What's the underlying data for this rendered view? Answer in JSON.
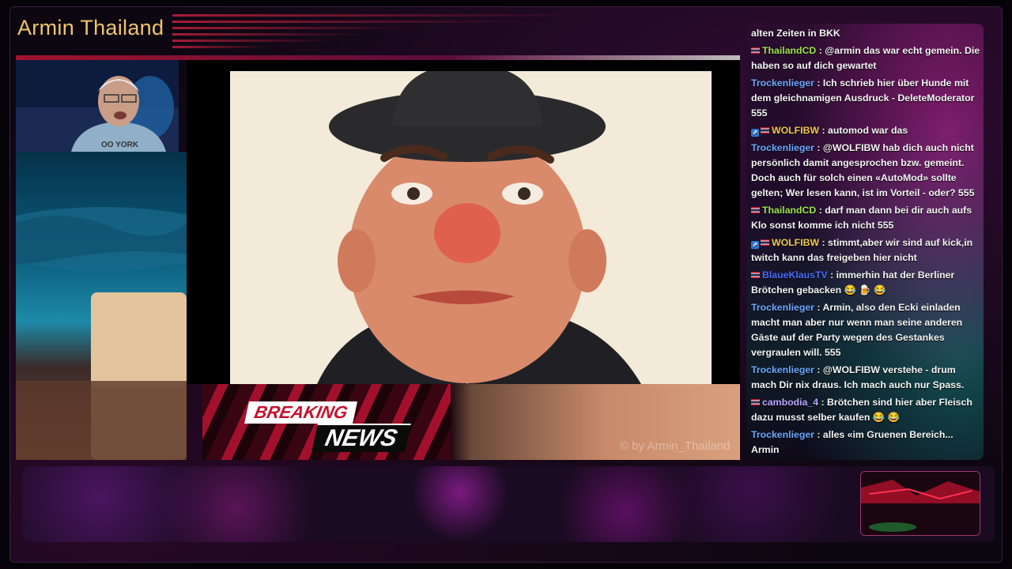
{
  "stream": {
    "channel_title": "Armin Thailand",
    "breaking_label": "BREAKING",
    "news_label": "NEWS",
    "watermark": "© by Armin_Thailand"
  },
  "colors": {
    "title": "#f2c46a",
    "breaking_red": "#c5102d",
    "user_green": "#9be34a",
    "user_blue": "#6aa8ff",
    "user_yellow": "#f0c84a",
    "user_lightblue": "#7fd0ff",
    "user_purple": "#b9a6ff",
    "user_deepblue": "#4a6aff"
  },
  "chat": {
    "messages": [
      {
        "user": "",
        "text": "alten Zeiten in BKK",
        "flag": false,
        "badge": false,
        "color": "#f4f4f4"
      },
      {
        "user": "ThailandCD",
        "text": " : @armin das war echt gemein. Die haben so auf dich gewartet",
        "flag": true,
        "badge": false,
        "color": "#9be34a"
      },
      {
        "user": "Trockenlieger",
        "text": " : Ich schrieb hier über Hunde mit dem gleichnamigen Ausdruck - DeleteModerator 555",
        "flag": false,
        "badge": false,
        "color": "#6aa8ff"
      },
      {
        "user": "WOLFIBW",
        "text": " : automod war das",
        "flag": true,
        "badge": true,
        "color": "#f0c84a"
      },
      {
        "user": "Trockenlieger",
        "text": " : @WOLFIBW hab dich auch nicht persönlich damit angesprochen bzw. gemeint. Doch auch für solch einen «AutoMod» sollte gelten; Wer lesen kann, ist im Vorteil - oder? 555",
        "flag": false,
        "badge": false,
        "color": "#6aa8ff"
      },
      {
        "user": "ThailandCD",
        "text": " : darf man dann bei dir auch aufs Klo sonst komme ich nicht 555",
        "flag": true,
        "badge": false,
        "color": "#9be34a"
      },
      {
        "user": "WOLFIBW",
        "text": " : stimmt,aber wir sind auf kick,in twitch kann das freigeben hier nicht",
        "flag": true,
        "badge": true,
        "color": "#f0c84a"
      },
      {
        "user": "BlaueKlausTV",
        "text": " : immerhin hat der Berliner Brötchen gebacken 😂 🍺 😂",
        "flag": true,
        "badge": false,
        "color": "#4a6aff"
      },
      {
        "user": "Trockenlieger",
        "text": " : Armin, also den Ecki einladen macht man aber nur wenn man seine anderen Gäste auf der Party wegen des Gestankes vergraulen will. 555",
        "flag": false,
        "badge": false,
        "color": "#6aa8ff"
      },
      {
        "user": "Trockenlieger",
        "text": " : @WOLFIBW verstehe - drum mach Dir nix draus. Ich mach auch nur Spass.",
        "flag": false,
        "badge": false,
        "color": "#6aa8ff"
      },
      {
        "user": "cambodia_4",
        "text": " : Brötchen sind hier aber Fleisch dazu musst selber kaufen 😂 😂",
        "flag": true,
        "badge": false,
        "color": "#b9a6ff"
      },
      {
        "user": "Trockenlieger",
        "text": " : alles «im Gruenen Bereich... Armin",
        "flag": false,
        "badge": false,
        "color": "#6aa8ff"
      }
    ]
  }
}
